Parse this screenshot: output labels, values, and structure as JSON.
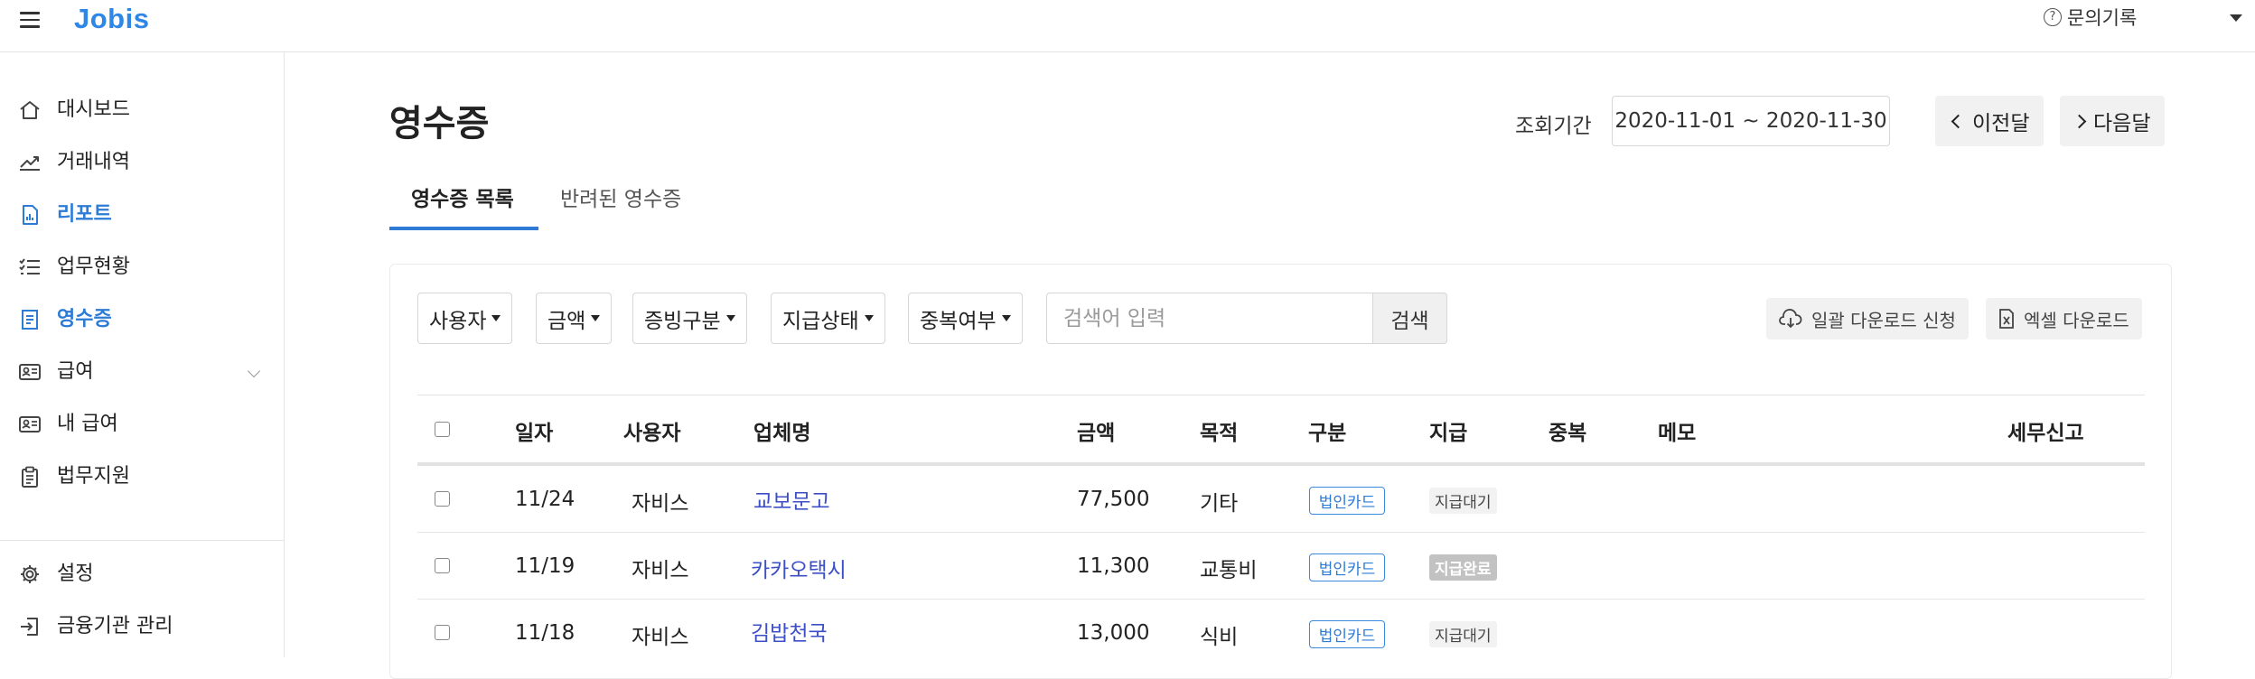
{
  "app": {
    "logo": "Jobis",
    "help_label": "문의기록"
  },
  "sidebar": {
    "items": [
      {
        "label": "대시보드",
        "icon": "home-icon"
      },
      {
        "label": "거래내역",
        "icon": "trend-icon"
      },
      {
        "label": "리포트",
        "icon": "report-icon",
        "active": true
      },
      {
        "label": "업무현황",
        "icon": "checklist-icon"
      },
      {
        "label": "영수증",
        "icon": "receipt-icon",
        "active": true
      },
      {
        "label": "급여",
        "icon": "id-card-icon",
        "expandable": true
      },
      {
        "label": "내 급여",
        "icon": "id-card-icon"
      },
      {
        "label": "법무지원",
        "icon": "clipboard-icon"
      }
    ],
    "bottom_items": [
      {
        "label": "설정",
        "icon": "gear-icon"
      },
      {
        "label": "금융기관 관리",
        "icon": "bank-login-icon"
      }
    ]
  },
  "page": {
    "title": "영수증",
    "period_label": "조회기간",
    "period_value": "2020-11-01 ~ 2020-11-30",
    "prev_label": "이전달",
    "next_label": "다음달"
  },
  "tabs": [
    {
      "label": "영수증 목록",
      "active": true
    },
    {
      "label": "반려된 영수증",
      "active": false
    }
  ],
  "filters": [
    {
      "label": "사용자"
    },
    {
      "label": "금액"
    },
    {
      "label": "증빙구분"
    },
    {
      "label": "지급상태"
    },
    {
      "label": "중복여부"
    }
  ],
  "search": {
    "placeholder": "검색어 입력",
    "button": "검색"
  },
  "downloads": {
    "bulk_label": "일괄 다운로드 신청",
    "excel_label": "엑셀 다운로드"
  },
  "table": {
    "headers": [
      "일자",
      "사용자",
      "업체명",
      "금액",
      "목적",
      "구분",
      "지급",
      "중복",
      "메모",
      "세무신고"
    ],
    "rows": [
      {
        "date": "11/24",
        "user": "자비스",
        "vendor": "교보문고",
        "amount": "77,500",
        "purpose": "기타",
        "type": "법인카드",
        "pay": "지급대기",
        "pay_status": "wait"
      },
      {
        "date": "11/19",
        "user": "자비스",
        "vendor": "카카오택시",
        "amount": "11,300",
        "purpose": "교통비",
        "type": "법인카드",
        "pay": "지급완료",
        "pay_status": "done"
      },
      {
        "date": "11/18",
        "user": "자비스",
        "vendor": "김밥천국",
        "amount": "13,000",
        "purpose": "식비",
        "type": "법인카드",
        "pay": "지급대기",
        "pay_status": "wait"
      }
    ]
  },
  "colors": {
    "brand": "#2e86e6",
    "active": "#2e7bd6",
    "link": "#3d4fc6"
  }
}
